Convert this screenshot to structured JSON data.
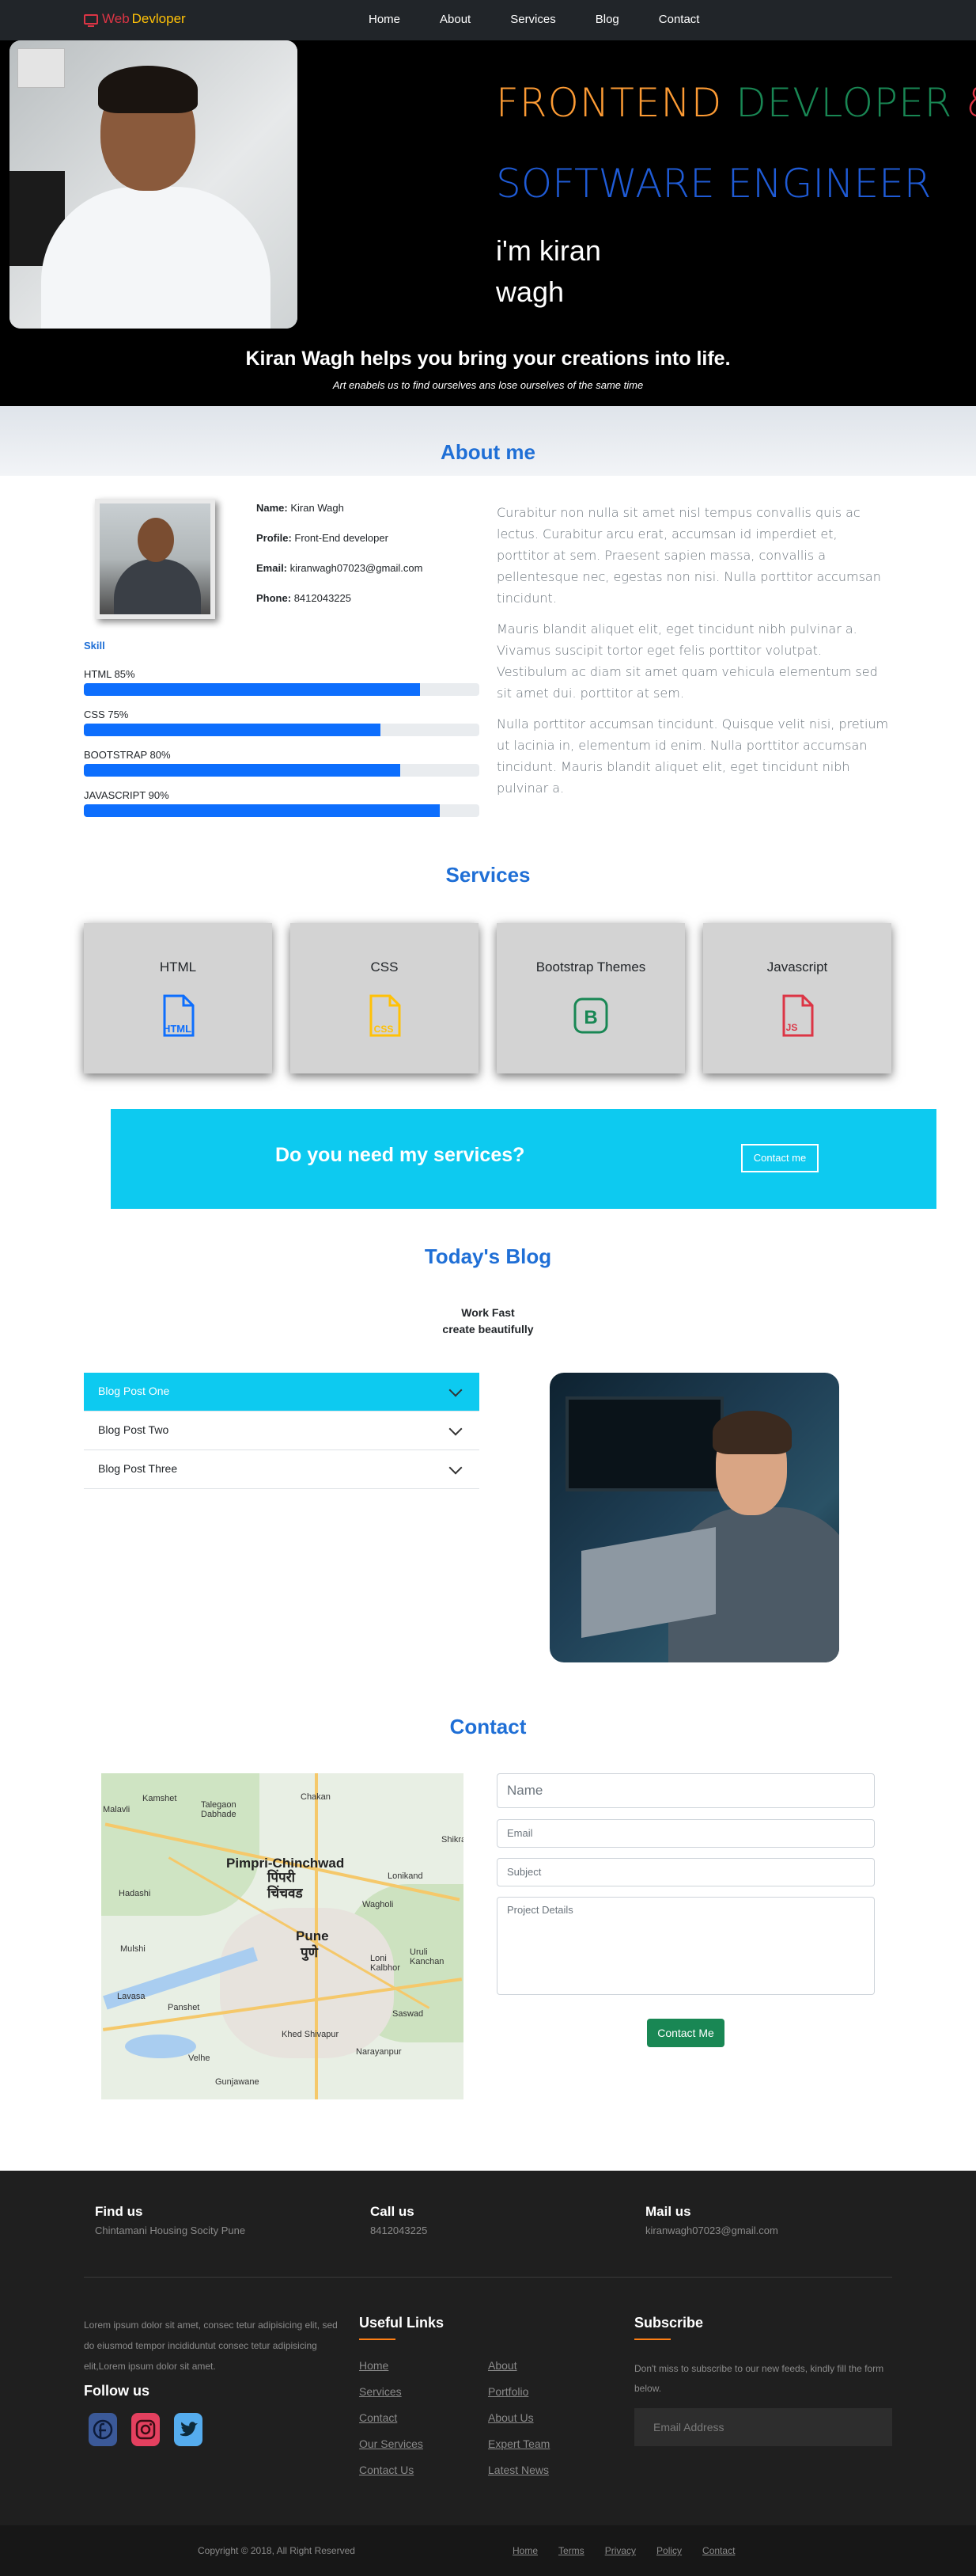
{
  "nav": {
    "brand_red": "Web",
    "brand_yellow": "Devloper",
    "links": [
      "Home",
      "About",
      "Services",
      "Blog",
      "Contact"
    ]
  },
  "hero": {
    "title_line1": [
      "FRONTEND",
      "DEVLOPER",
      "&"
    ],
    "title_line2": "SOFTWARE ENGINEER",
    "name_line1": "i'm kiran",
    "name_line2": "wagh",
    "tagline": "Kiran Wagh helps you bring your creations into life.",
    "subtagline": "Art enabels us to find ourselves ans lose ourselves of the same time"
  },
  "about": {
    "title": "About me",
    "name_label": "Name:",
    "name_value": "Kiran Wagh",
    "profile_label": "Profile:",
    "profile_value": "Front-End developer",
    "email_label": "Email:",
    "email_value": "kiranwagh07023@gmail.com",
    "phone_label": "Phone:",
    "phone_value": "8412043225",
    "skill_heading": "Skill",
    "skills": [
      {
        "label": "HTML 85%",
        "percent": 85
      },
      {
        "label": "CSS 75%",
        "percent": 75
      },
      {
        "label": "BOOTSTRAP 80%",
        "percent": 80
      },
      {
        "label": "JAVASCRIPT 90%",
        "percent": 90
      }
    ],
    "paragraphs": [
      "Curabitur non nulla sit amet nisl tempus convallis quis ac lectus. Curabitur arcu erat, accumsan id imperdiet et, porttitor at sem. Praesent sapien massa, convallis a pellentesque nec, egestas non nisi. Nulla porttitor accumsan tincidunt.",
      "Mauris blandit aliquet elit, eget tincidunt nibh pulvinar a. Vivamus suscipit tortor eget felis porttitor volutpat. Vestibulum ac diam sit amet quam vehicula elementum sed sit amet dui. porttitor at sem.",
      "Nulla porttitor accumsan tincidunt. Quisque velit nisi, pretium ut lacinia in, elementum id enim. Nulla porttitor accumsan tincidunt. Mauris blandit aliquet elit, eget tincidunt nibh pulvinar a."
    ]
  },
  "services": {
    "title": "Services",
    "cards": [
      {
        "title": "HTML",
        "icon": "html-file-icon",
        "icon_text": "HTML",
        "color": "#0d6efd"
      },
      {
        "title": "CSS",
        "icon": "css-file-icon",
        "icon_text": "CSS",
        "color": "#ffc107"
      },
      {
        "title": "Bootstrap Themes",
        "icon": "bootstrap-icon",
        "icon_text": "B",
        "color": "#198754"
      },
      {
        "title": "Javascript",
        "icon": "js-file-icon",
        "icon_text": "JS",
        "color": "#dc3545"
      }
    ],
    "cta_question": "Do you need my services?",
    "cta_button": "Contact me"
  },
  "blog": {
    "title": "Today's Blog",
    "sub1": "Work Fast",
    "sub2": "create beautifully",
    "posts": [
      "Blog Post One",
      "Blog Post Two",
      "Blog Post Three"
    ]
  },
  "contact": {
    "title": "Contact",
    "map_labels": {
      "city1": "Pimpri-Chinchwad",
      "city1_local": "पिंपरी चिंचवड",
      "city2": "Pune",
      "city2_local": "पुणे",
      "small": [
        "Kamshet",
        "Talegaon Dabhade",
        "Chakan",
        "Malavli",
        "Shikrapur",
        "Lonikand",
        "Hadashi",
        "Wagholi",
        "Mulshi",
        "Uruli Kanchan",
        "Loni Kalbhor",
        "Panshet",
        "Saswad",
        "Lavasa",
        "Khed Shivapur",
        "Velhe",
        "Narayanpur",
        "Gunjawane"
      ]
    },
    "name_placeholder": "Name",
    "email_placeholder": "Email",
    "subject_placeholder": "Subject",
    "details_placeholder": "Project Details",
    "submit": "Contact Me"
  },
  "footer": {
    "find_title": "Find us",
    "find_value": "Chintamani Housing Socity Pune",
    "call_title": "Call us",
    "call_value": "8412043225",
    "mail_title": "Mail us",
    "mail_value": "kiranwagh07023@gmail.com",
    "lorem": "Lorem ipsum dolor sit amet, consec tetur adipisicing elit, sed do eiusmod tempor incididuntut consec tetur adipisicing elit,Lorem ipsum dolor sit amet.",
    "follow": "Follow us",
    "useful_title": "Useful Links",
    "links_col1": [
      "Home",
      "Services",
      "Contact",
      "Our Services",
      "Contact Us"
    ],
    "links_col2": [
      "About",
      "Portfolio",
      "About Us",
      "Expert Team",
      "Latest News"
    ],
    "subscribe_title": "Subscribe",
    "subscribe_text": "Don't miss to subscribe to our new feeds, kindly fill the form below.",
    "email_placeholder": "Email Address",
    "copyright": "Copyright © 2018, All Right Reserved",
    "bottom_links": [
      "Home",
      "Terms",
      "Privacy",
      "Policy",
      "Contact"
    ]
  }
}
